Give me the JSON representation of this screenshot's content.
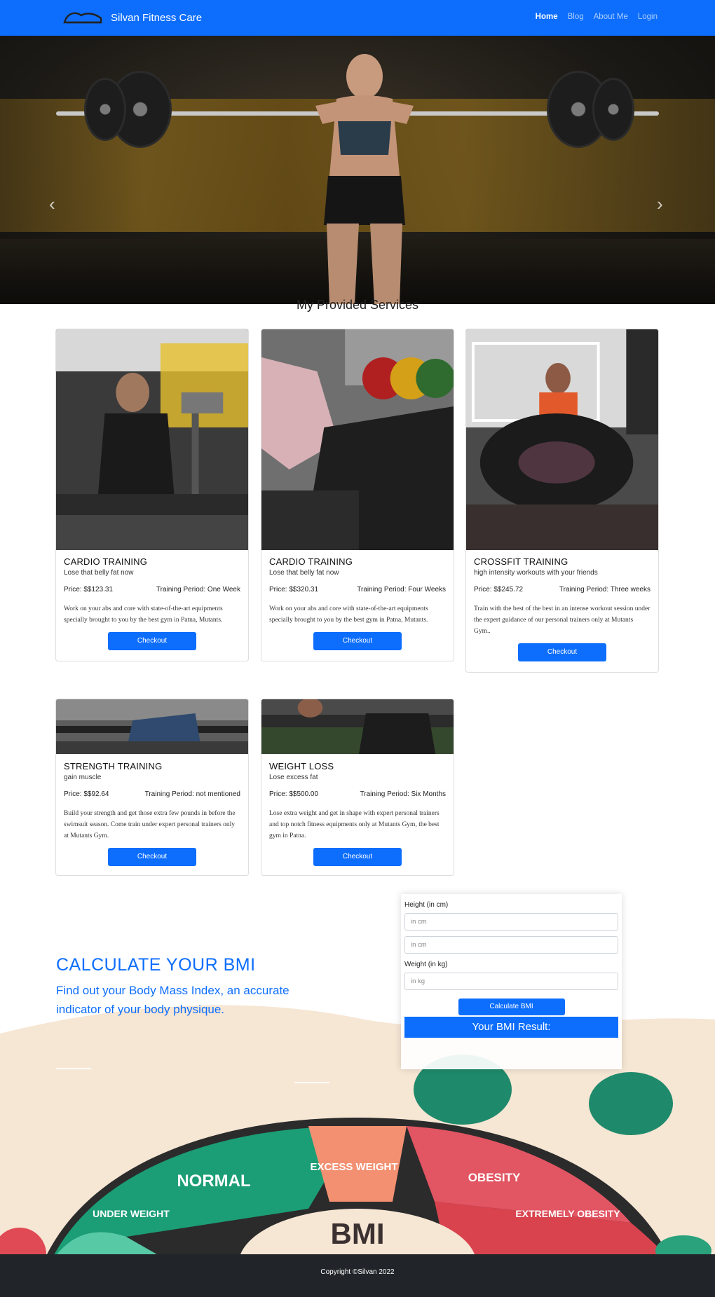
{
  "brand": {
    "name": "Silvan Fitness Care"
  },
  "nav": {
    "items": [
      "Home",
      "Blog",
      "About Me",
      "Login"
    ],
    "active": "Home"
  },
  "hero": {
    "prev_icon": "chevron-left-icon",
    "next_icon": "chevron-right-icon"
  },
  "services": {
    "title": "My Provided Services",
    "cards": [
      {
        "title": "CARDIO TRAINING",
        "subtitle": "Lose that belly fat now",
        "price": "Price: $$123.31",
        "period": "Training Period: One Week",
        "description": "Work on your abs and core with state-of-the-art equipments specially brought to you by the best gym in Patna, Mutants.",
        "button": "Checkout"
      },
      {
        "title": "CARDIO TRAINING",
        "subtitle": "Lose that belly fat now",
        "price": "Price: $$320.31",
        "period": "Training Period: Four Weeks",
        "description": "Work on your abs and core with state-of-the-art equipments specially brought to you by the best gym in Patna, Mutants.",
        "button": "Checkout"
      },
      {
        "title": "CROSSFIT TRAINING",
        "subtitle": "high intensity workouts with your friends",
        "price": "Price: $$245.72",
        "period": "Training Period: Three weeks",
        "description": "Train with the best of the best in an intense workout session under the expert guidance of our personal trainers only at Mutants Gym..",
        "button": "Checkout"
      },
      {
        "title": "STRENGTH TRAINING",
        "subtitle": "gain muscle",
        "price": "Price: $$92.64",
        "period": "Training Period: not mentioned",
        "description": "Build your strength and get those extra few pounds in before the swimsuit season. Come train under expert personal trainers only at Mutants Gym.",
        "button": "Checkout"
      },
      {
        "title": "WEIGHT LOSS",
        "subtitle": "Lose excess fat",
        "price": "Price: $$500.00",
        "period": "Training Period: Six Months",
        "description": "Lose extra weight and get in shape with expert personal trainers and top notch fitness equipments only at Mutants Gym, the best gym in Patna.",
        "button": "Checkout"
      }
    ]
  },
  "bmi": {
    "title": "CALCULATE YOUR BMI",
    "text": "Find out your Body Mass Index, an accurate indicator of your body physique.",
    "height_label": "Height (in cm)",
    "height_placeholder": "in cm",
    "height_placeholder_2": "in cm",
    "weight_label": "Weight (in kg)",
    "weight_placeholder": "in kg",
    "button": "Calculate BMI",
    "result_label": "Your BMI Result:",
    "chart_labels": [
      "NORMAL",
      "EXCESS WEIGHT",
      "OBESITY",
      "UNDER WEIGHT",
      "EXTREMELY OBESITY",
      "BMI"
    ]
  },
  "footer": {
    "copyright": "Copyright ©Silvan 2022"
  }
}
